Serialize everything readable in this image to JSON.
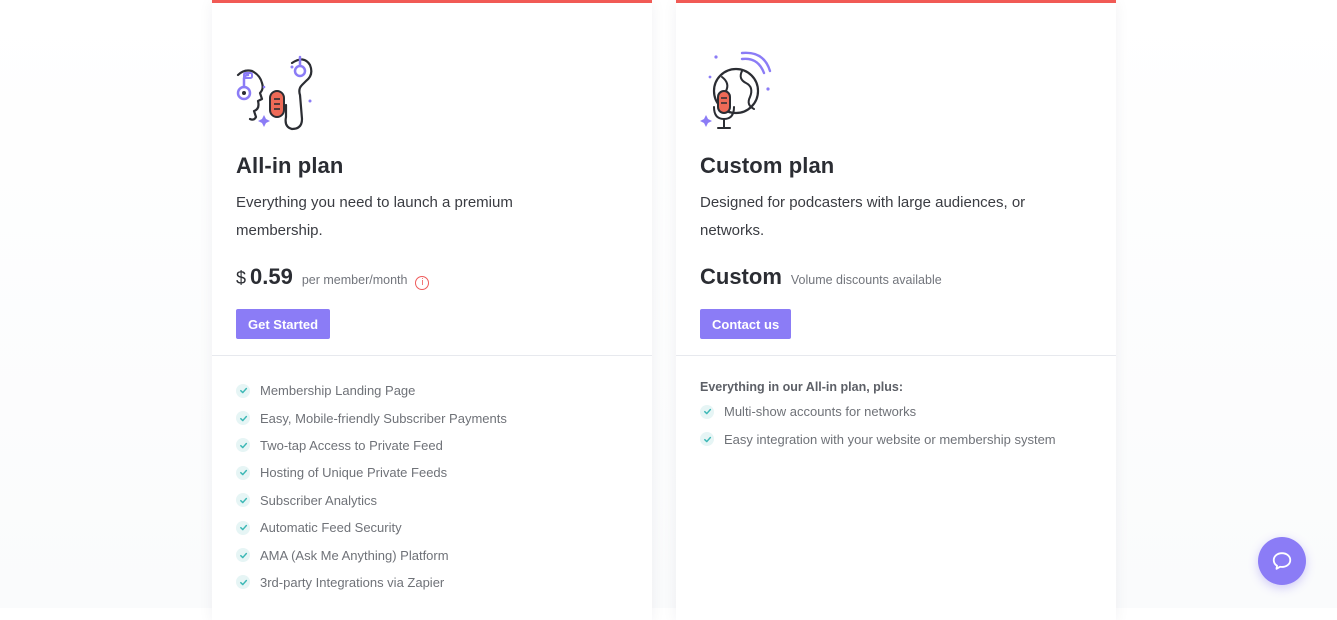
{
  "plans": [
    {
      "title": "All-in plan",
      "description": "Everything you need to launch a premium membership.",
      "currency": "$",
      "price": "0.59",
      "price_unit": "per member/month",
      "info_icon": "info-circle-icon",
      "cta_label": "Get Started",
      "features": [
        "Membership Landing Page",
        "Easy, Mobile-friendly Subscriber Payments",
        "Two-tap Access to Private Feed",
        "Hosting of Unique Private Feeds",
        "Subscriber Analytics",
        "Automatic Feed Security",
        "AMA (Ask Me Anything) Platform",
        "3rd-party Integrations via Zapier"
      ]
    },
    {
      "title": "Custom plan",
      "description": "Designed for podcasters with large audiences, or networks.",
      "price": "Custom",
      "price_unit": "Volume discounts available",
      "cta_label": "Contact us",
      "features_intro": "Everything in our All-in plan, plus:",
      "features": [
        "Multi-show accounts for networks",
        "Easy integration with your website or membership system"
      ]
    }
  ],
  "icons": {
    "plan1_illustration": "podcasters-headphones-microphone-illustration",
    "plan2_illustration": "globe-microphone-illustration",
    "feature_check": "check-icon",
    "chat": "chat-bubble-icon"
  },
  "colors": {
    "accent": "#8b7cf6",
    "top_border": "#f15a55",
    "check": "#3bb7b5"
  }
}
